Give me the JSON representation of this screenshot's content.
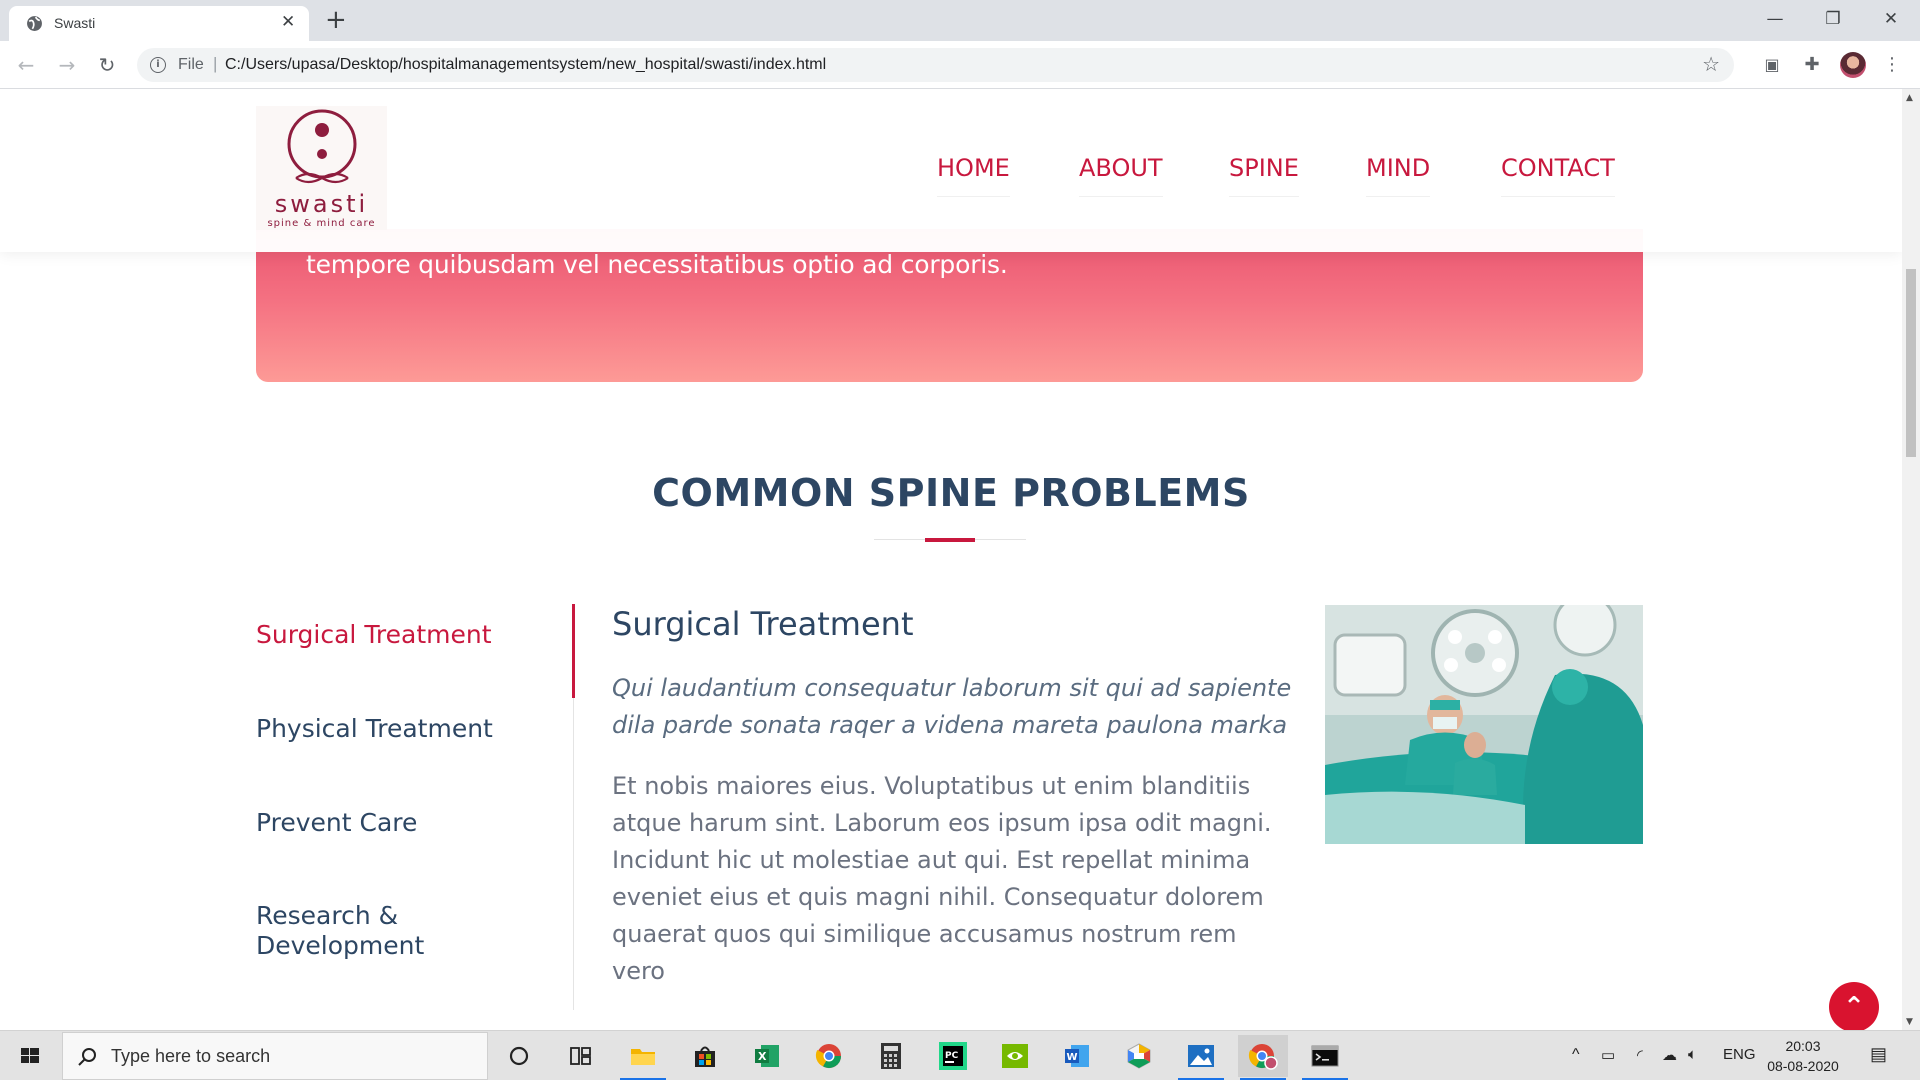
{
  "browser": {
    "tab_title": "Swasti",
    "tab_close": "✕",
    "new_tab": "+",
    "scheme": "File",
    "scheme_sep": "|",
    "url": "C:/Users/upasa/Desktop/hospitalmanagementsystem/new_hospital/swasti/index.html",
    "window": {
      "minimize": "—",
      "restore": "❐",
      "close": "✕"
    },
    "nav": {
      "back": "←",
      "forward": "→",
      "reload": "↻",
      "star": "☆",
      "extensions": "✚",
      "menu": "⋮"
    }
  },
  "site": {
    "logo": {
      "word": "swasti",
      "tagline": "spine & mind care",
      "color": "#8e1d3e"
    },
    "nav": [
      "HOME",
      "ABOUT",
      "SPINE",
      "MIND",
      "CONTACT"
    ],
    "hero_text": "tempore quibusdam vel necessitatibus optio ad corporis.",
    "section_title": "COMMON SPINE PROBLEMS",
    "tabs": [
      "Surgical Treatment",
      "Physical Treatment",
      "Prevent Care",
      "Research & Development"
    ],
    "active_tab": 0,
    "content": {
      "heading": "Surgical Treatment",
      "lead": "Qui laudantium consequatur laborum sit qui ad sapiente dila parde sonata raqer a videna mareta paulona marka",
      "body": "Et nobis maiores eius. Voluptatibus ut enim blanditiis atque harum sint. Laborum eos ipsum ipsa odit magni. Incidunt hic ut molestiae aut qui. Est repellat minima eveniet eius et quis magni nihil. Consequatur dolorem quaerat quos qui similique accusamus nostrum rem vero"
    },
    "back_to_top": "⌃",
    "colors": {
      "accent": "#c8183e",
      "heading": "#2d4663",
      "hero_top": "#e9546f",
      "hero_bottom": "#fd9a96"
    }
  },
  "taskbar": {
    "search_placeholder": "Type here to search",
    "apps": [
      "cortana-icon",
      "task-view-icon",
      "file-explorer-icon",
      "store-icon",
      "excel-icon",
      "chrome-icon",
      "calculator-icon",
      "pycharm-icon",
      "nvidia-icon",
      "word-icon",
      "app-icon",
      "photos-icon",
      "chrome-profile-icon",
      "terminal-icon"
    ],
    "tray": {
      "language": "ENG",
      "time": "20:03",
      "date": "08-08-2020"
    }
  }
}
